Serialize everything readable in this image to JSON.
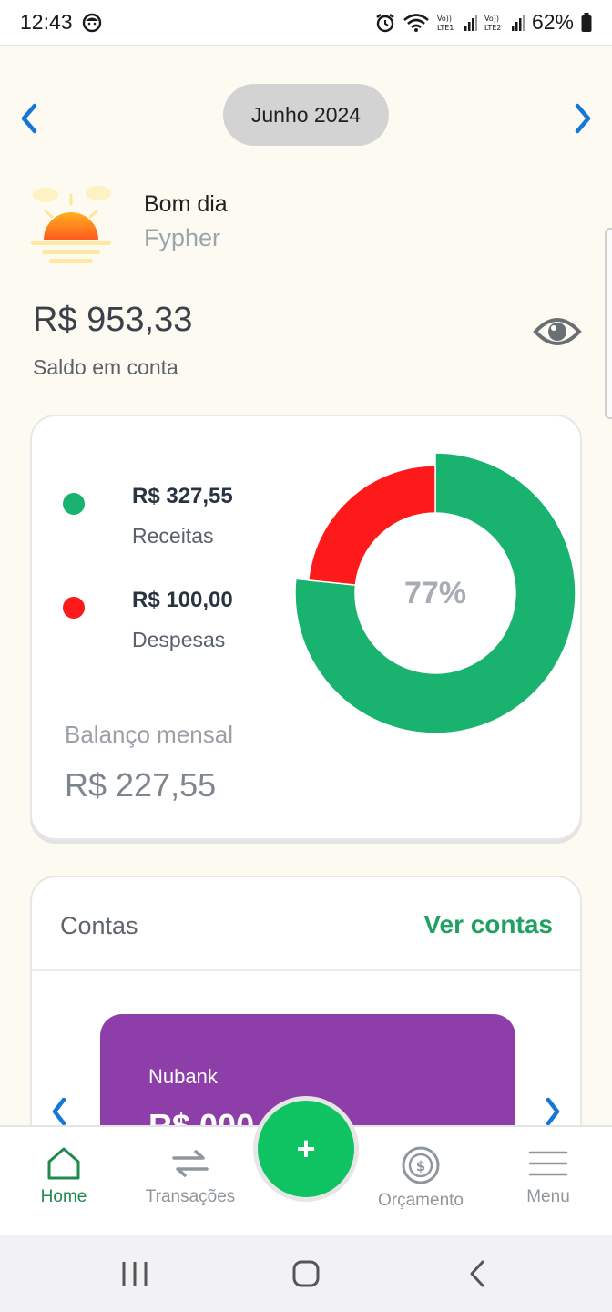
{
  "status_bar": {
    "time": "12:43",
    "battery": "62%",
    "icons": [
      "face-icon",
      "alarm-icon",
      "wifi-icon",
      "signal-lte1-icon",
      "signal-lte2-icon",
      "battery-icon"
    ]
  },
  "month": {
    "label": "Junho 2024",
    "prev_icon": "chevron-left-icon",
    "next_icon": "chevron-right-icon"
  },
  "greeting": {
    "title": "Bom dia",
    "name": "Fypher",
    "icon": "sunrise-icon"
  },
  "balance": {
    "value": "R$ 953,33",
    "label": "Saldo em conta",
    "visibility_icon": "eye-icon"
  },
  "summary": {
    "income_amount": "R$ 327,55",
    "income_label": "Receitas",
    "expense_amount": "R$ 100,00",
    "expense_label": "Despesas",
    "monthly_label": "Balanço mensal",
    "monthly_value": "R$ 227,55",
    "donut_percent": "77%",
    "colors": {
      "income": "#19b36f",
      "expense": "#fe1a1a"
    }
  },
  "chart_data": {
    "type": "pie",
    "categories": [
      "Receitas",
      "Despesas"
    ],
    "values": [
      327.55,
      100.0
    ],
    "center_label": "77%"
  },
  "accounts": {
    "title": "Contas",
    "link": "Ver contas",
    "tile_name": "Nubank",
    "tile_value": "R$ 000",
    "tile_color": "#8e3ea8"
  },
  "bottom_nav": {
    "items": [
      {
        "label": "Home",
        "icon": "home-icon"
      },
      {
        "label": "Transações",
        "icon": "transfer-icon"
      },
      {
        "label": "Orçamento",
        "icon": "budget-icon"
      },
      {
        "label": "Menu",
        "icon": "menu-icon"
      }
    ],
    "fab_label": "+"
  }
}
